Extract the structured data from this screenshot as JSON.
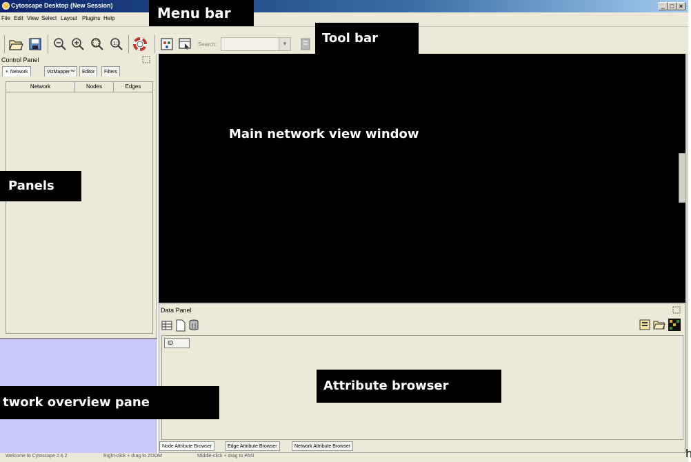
{
  "window": {
    "title": "Cytoscape Desktop (New Session)",
    "controls": [
      "_",
      "3",
      "x"
    ]
  },
  "menubar": {
    "items": [
      "File",
      "Edit",
      "View",
      "Select",
      "Layout",
      "Plugins",
      "Help"
    ]
  },
  "toolbar": {
    "icons": [
      "open-session-icon",
      "save-session-icon",
      "zoom-out-icon",
      "zoom-in-icon",
      "zoom-selected-icon",
      "zoom-fit-icon",
      "help-icon",
      "create-network-icon",
      "select-icon",
      "attribute-icon"
    ],
    "search_label": "Search:",
    "search_value": ""
  },
  "control_panel": {
    "title": "Control Panel",
    "tabs": [
      "Network",
      "VizMapper™",
      "Editor",
      "Filters"
    ],
    "table_columns": [
      "Network",
      "Nodes",
      "Edges"
    ]
  },
  "data_panel": {
    "title": "Data Panel",
    "id_column": "ID",
    "browser_tabs": [
      "Node Attribute Browser",
      "Edge Attribute Browser",
      "Network Attribute Browser"
    ]
  },
  "statusbar": {
    "welcome": "Welcome to Cytoscape 2.6.2",
    "hint_zoom": "Right-click + drag to ZOOM",
    "hint_pan": "Middle-click + drag to PAN"
  },
  "annotations": {
    "menu_bar": "Menu bar",
    "tool_bar": "Tool  bar",
    "main_view": "Main network view window",
    "panels": "Panels",
    "overview": "twork overview pane",
    "attribute_browser": "Attribute browser",
    "edge_char": "h"
  },
  "colors": {
    "title_gradient_start": "#0a246a",
    "chrome": "#ece9d8",
    "network_view": "#000000",
    "overview_pane": "#c9c9f7"
  }
}
